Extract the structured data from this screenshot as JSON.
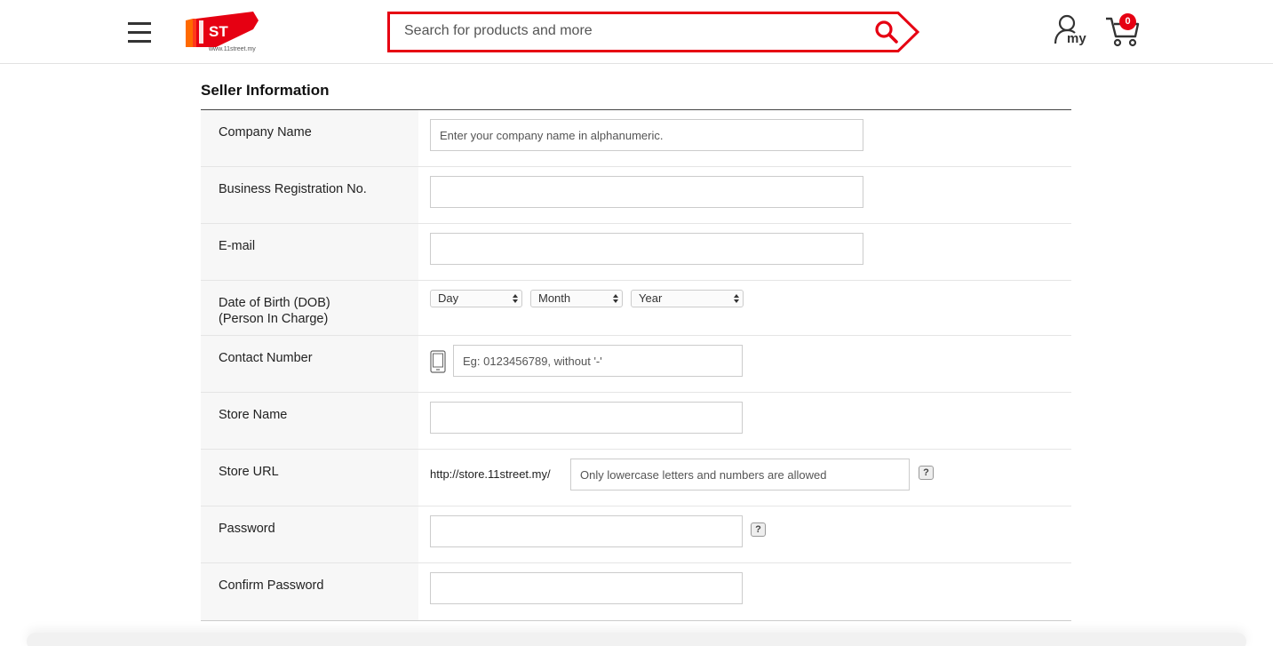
{
  "header": {
    "menu_icon": "hamburger-icon",
    "logo_text": "ST",
    "logo_url": "www.11street.my",
    "search": {
      "placeholder": "Search for products and more",
      "button_icon": "search-icon"
    },
    "account": {
      "label": "my",
      "icon": "user-icon"
    },
    "cart": {
      "count": "0",
      "icon": "cart-icon"
    }
  },
  "colors": {
    "brand_red": "#e60012",
    "label_bg": "#f7f7f7",
    "border": "#cccccc"
  },
  "form": {
    "title": "Seller Information",
    "company_name": {
      "label": "Company Name",
      "placeholder": "Enter your company name in alphanumeric."
    },
    "business_reg": {
      "label": "Business Registration No.",
      "value": ""
    },
    "email": {
      "label": "E-mail",
      "value": ""
    },
    "dob": {
      "label_line1": "Date of Birth (DOB)",
      "label_line2": "(Person In Charge)",
      "day": "Day",
      "month": "Month",
      "year": "Year"
    },
    "contact": {
      "label": "Contact Number",
      "placeholder": "Eg: 0123456789, without '-'",
      "icon": "mobile-phone-icon"
    },
    "store_name": {
      "label": "Store Name",
      "value": ""
    },
    "store_url": {
      "label": "Store URL",
      "prefix": "http://store.11street.my/",
      "placeholder": "Only lowercase letters and numbers are allowed",
      "help": "?"
    },
    "password": {
      "label": "Password",
      "help": "?"
    },
    "confirm_password": {
      "label": "Confirm Password"
    }
  }
}
